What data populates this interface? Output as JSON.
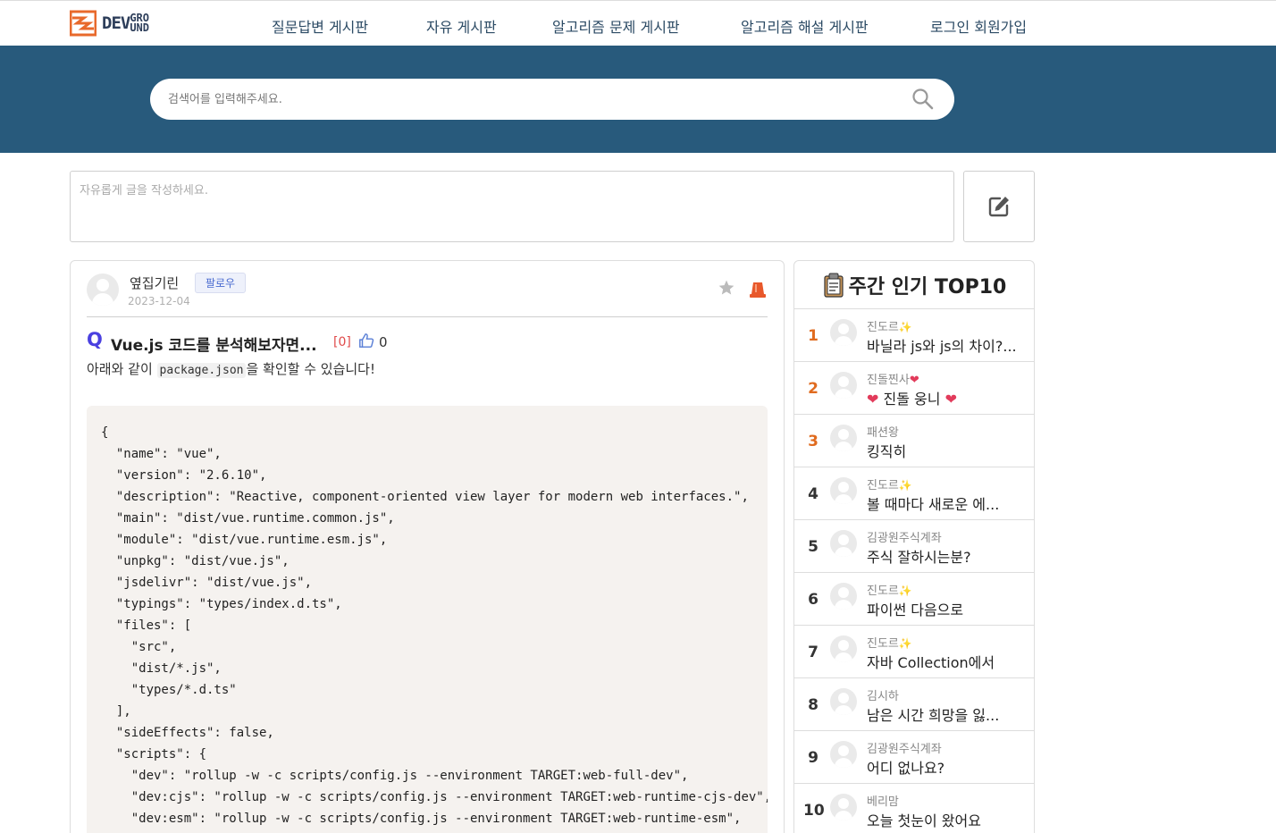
{
  "header": {
    "logo_text_main": "DEV",
    "logo_text_top": "GRO",
    "logo_text_bottom": "UND",
    "nav": [
      {
        "label": "질문답변 게시판"
      },
      {
        "label": "자유 게시판"
      },
      {
        "label": "알고리즘 문제 게시판"
      },
      {
        "label": "알고리즘 해설 게시판"
      },
      {
        "label": "로그인 회원가입"
      }
    ]
  },
  "search": {
    "placeholder": "검색어를 입력해주세요.",
    "icon": "search-icon"
  },
  "composer": {
    "placeholder": "자유롭게 글을 작성하세요.",
    "submit_icon": "edit-icon"
  },
  "post": {
    "author": "옆집기린",
    "follow_label": "팔로우",
    "date": "2023-12-04",
    "q_mark": "Q",
    "title": "Vue.js 코드를 분석해보자면...",
    "comment_count": "[0]",
    "like_count": "0",
    "body_before": "아래와 같이 ",
    "body_code": "package.json",
    "body_after": "을 확인할 수 있습니다!",
    "code": "{\n  \"name\": \"vue\",\n  \"version\": \"2.6.10\",\n  \"description\": \"Reactive, component-oriented view layer for modern web interfaces.\",\n  \"main\": \"dist/vue.runtime.common.js\",\n  \"module\": \"dist/vue.runtime.esm.js\",\n  \"unpkg\": \"dist/vue.js\",\n  \"jsdelivr\": \"dist/vue.js\",\n  \"typings\": \"types/index.d.ts\",\n  \"files\": [\n    \"src\",\n    \"dist/*.js\",\n    \"types/*.d.ts\"\n  ],\n  \"sideEffects\": false,\n  \"scripts\": {\n    \"dev\": \"rollup -w -c scripts/config.js --environment TARGET:web-full-dev\",\n    \"dev:cjs\": \"rollup -w -c scripts/config.js --environment TARGET:web-runtime-cjs-dev\",\n    \"dev:esm\": \"rollup -w -c scripts/config.js --environment TARGET:web-runtime-esm\","
  },
  "sidebar": {
    "title": "주간 인기 TOP10",
    "items": [
      {
        "rank": "1",
        "user": "진도르",
        "badge": true,
        "title": "바닐라 js와 js의 차이?...",
        "title_hearts": false
      },
      {
        "rank": "2",
        "user": "진돌찐사",
        "badge_heart": true,
        "title": "진돌 웅니",
        "title_hearts": true
      },
      {
        "rank": "3",
        "user": "패션왕",
        "title": "킹직히"
      },
      {
        "rank": "4",
        "user": "진도르",
        "badge": true,
        "title": "볼 때마다 새로운 에..."
      },
      {
        "rank": "5",
        "user": "김광원주식계좌",
        "title": "주식 잘하시는분?"
      },
      {
        "rank": "6",
        "user": "진도르",
        "badge": true,
        "title": "파이썬 다음으로"
      },
      {
        "rank": "7",
        "user": "진도르",
        "badge": true,
        "title": "자바 Collection에서"
      },
      {
        "rank": "8",
        "user": "김시하",
        "title": "남은 시간 희망을 잃..."
      },
      {
        "rank": "9",
        "user": "김광원주식계좌",
        "title": "어디 없나요?"
      },
      {
        "rank": "10",
        "user": "베리맘",
        "title": "오늘 첫눈이 왔어요"
      }
    ]
  },
  "colors": {
    "band": "#285a7c",
    "nav_text": "#2b4a64",
    "rank_hot": "#e06b1f",
    "q_mark": "#4a40e0",
    "comment_count": "#e04b4b"
  }
}
